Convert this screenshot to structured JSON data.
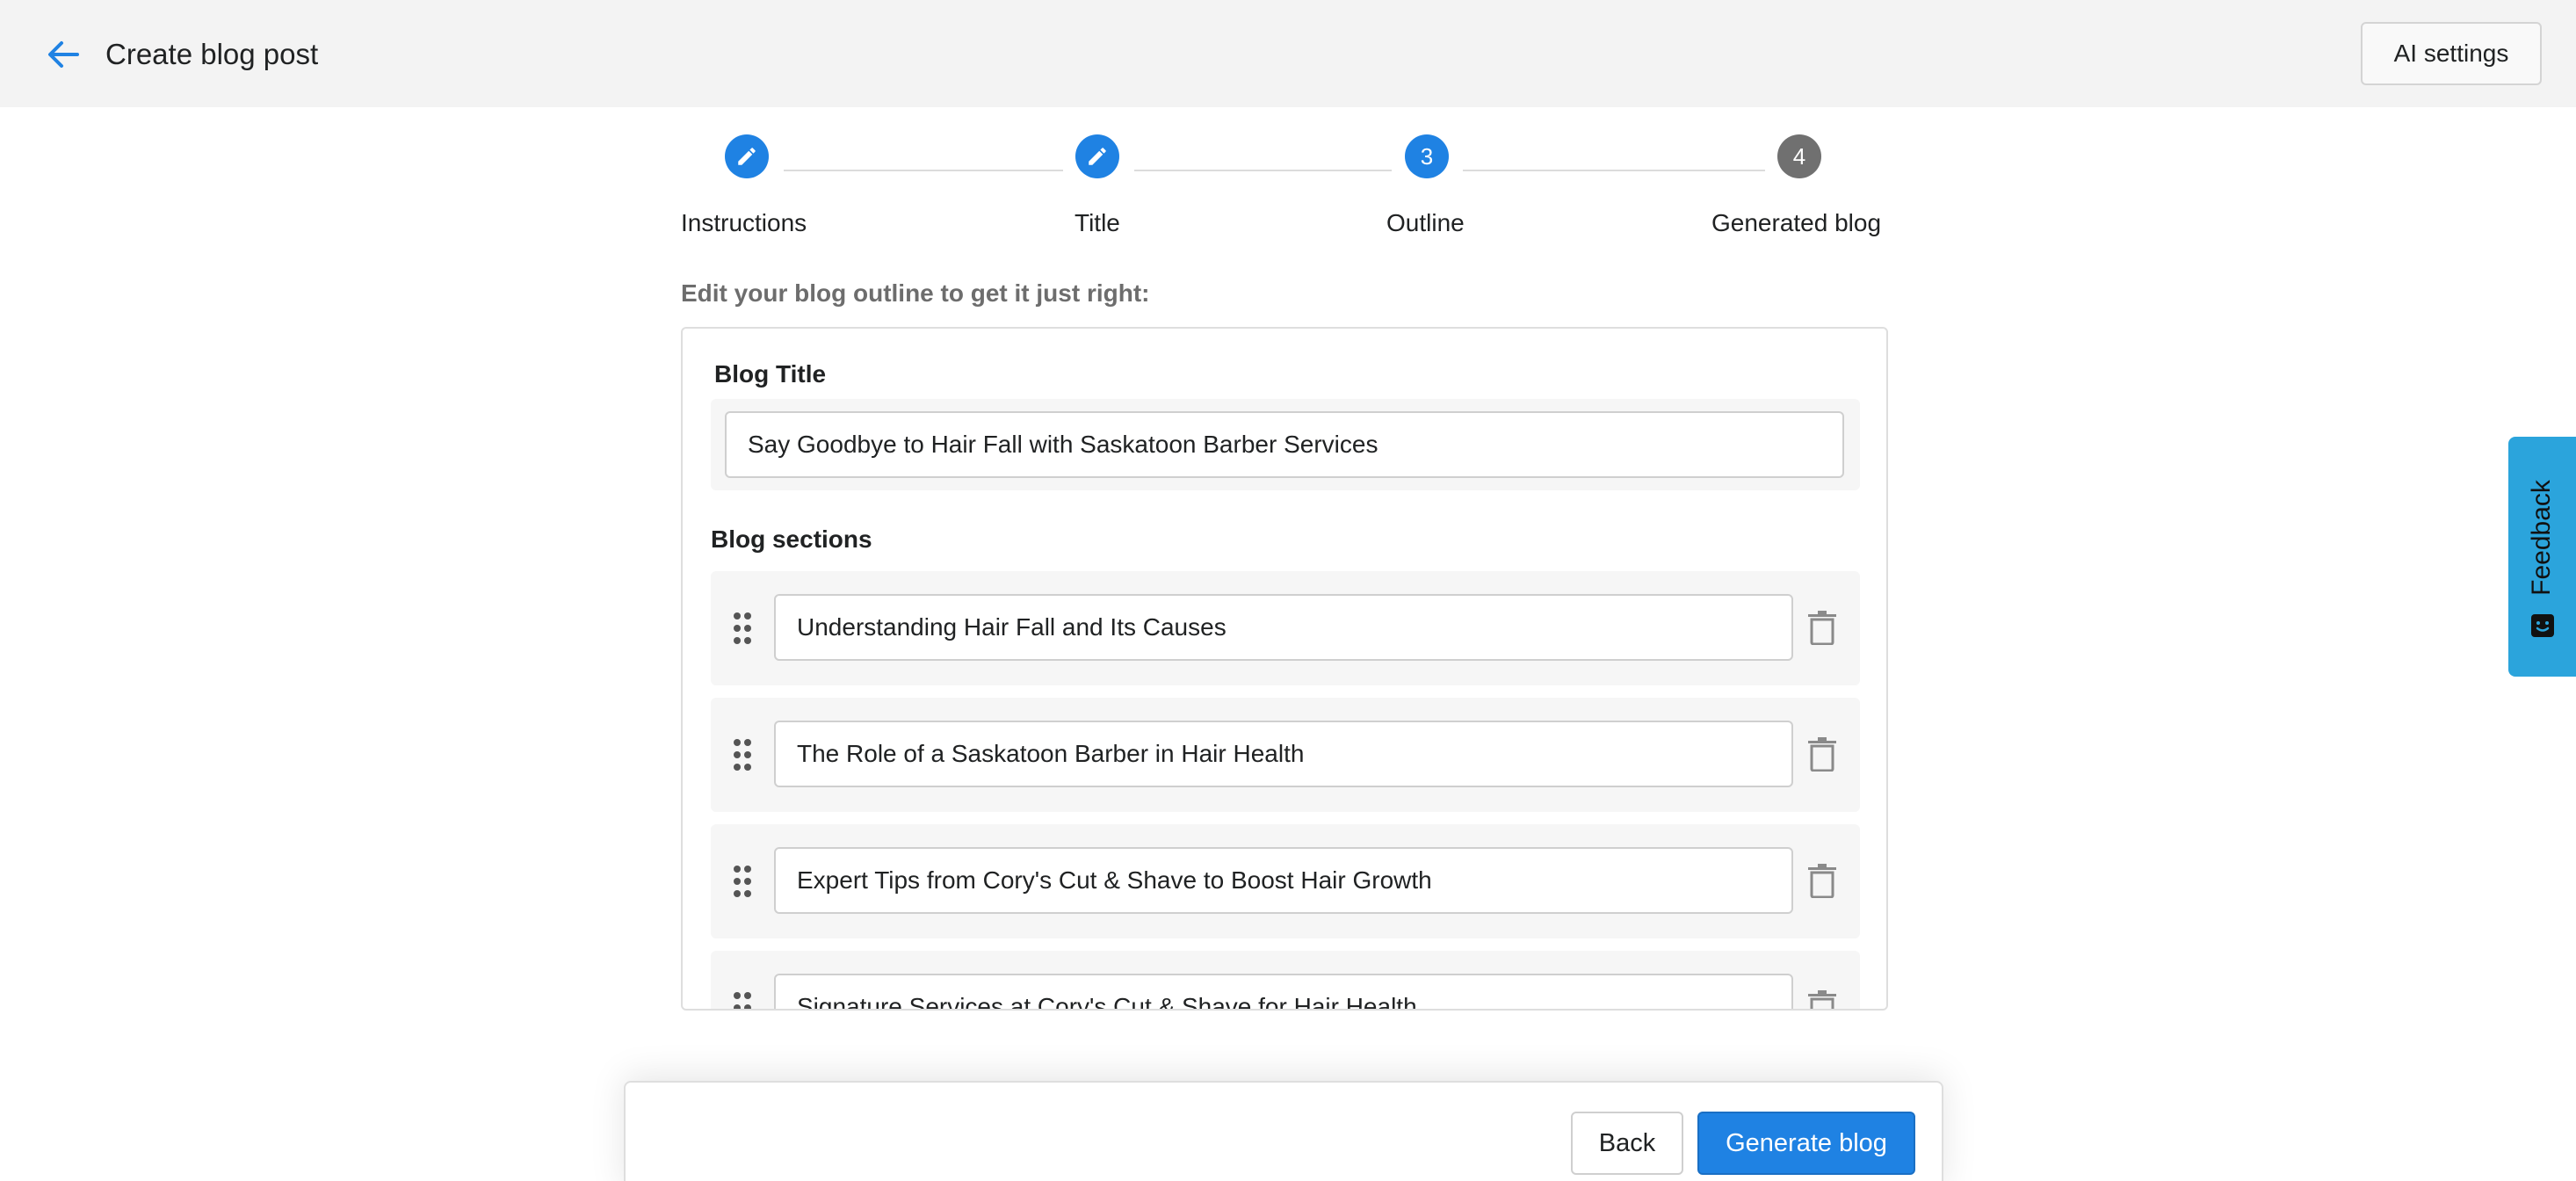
{
  "header": {
    "title": "Create blog post",
    "ai_settings_label": "AI settings"
  },
  "stepper": {
    "steps": [
      {
        "label": "Instructions",
        "state": "completed",
        "icon": "pencil-icon"
      },
      {
        "label": "Title",
        "state": "completed",
        "icon": "pencil-icon"
      },
      {
        "label": "Outline",
        "state": "active",
        "number": "3"
      },
      {
        "label": "Generated blog",
        "state": "pending",
        "number": "4"
      }
    ]
  },
  "outline": {
    "instruction": "Edit your blog outline to get it just right:",
    "blog_title_label": "Blog Title",
    "blog_title_value": "Say Goodbye to Hair Fall with Saskatoon Barber Services",
    "sections_label": "Blog sections",
    "sections": [
      "Understanding Hair Fall and Its Causes",
      "The Role of a Saskatoon Barber in Hair Health",
      "Expert Tips from Cory's Cut & Shave to Boost Hair Growth",
      "Signature Services at Cory's Cut & Shave for Hair Health"
    ]
  },
  "footer": {
    "back_label": "Back",
    "generate_label": "Generate blog"
  },
  "feedback": {
    "label": "Feedback"
  },
  "colors": {
    "accent": "#1f82e3",
    "pending_step": "#707070",
    "feedback_tab": "#2ba4dc",
    "header_bg": "#f3f3f3"
  }
}
